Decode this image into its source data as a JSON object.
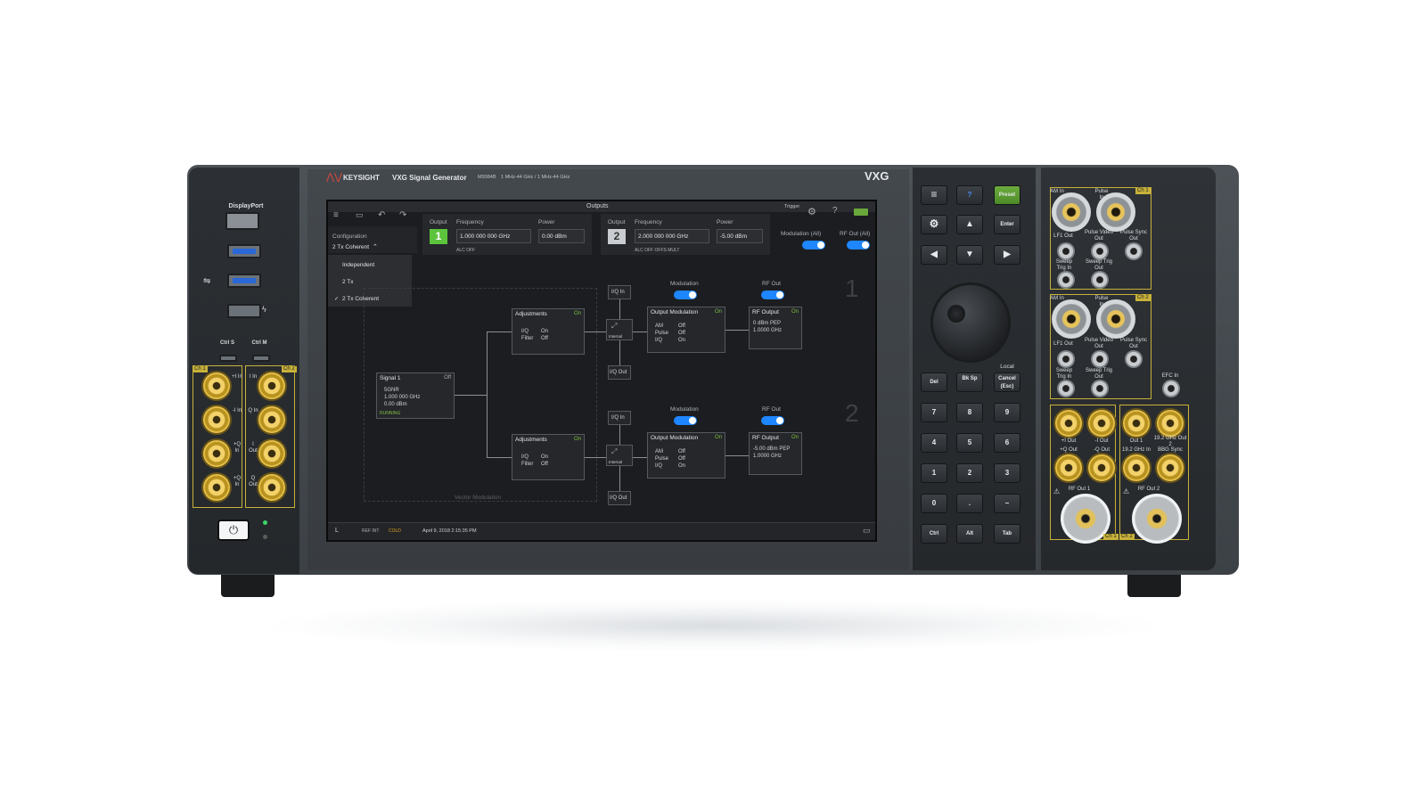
{
  "instrument": {
    "brand": "KEYSIGHT",
    "product": "VXG Signal Generator",
    "model": "M9384B",
    "freq_range": "1 MHz-44 GHz / 1 MHz-44 GHz",
    "badge": "VXG"
  },
  "left_panel": {
    "displayport": "DisplayPort",
    "ctrl_s": "Ctrl S",
    "ctrl_m": "Ctrl M",
    "ch1": "Ch 1",
    "ch2": "Ch 2",
    "port_labels_left": [
      "+I In",
      "-I In",
      "+Q In",
      "+Q In"
    ],
    "port_labels_right": [
      "I In",
      "Q In",
      "I Out",
      "Q Out"
    ]
  },
  "screen": {
    "top_title": "Outputs",
    "trigger": "Trigger",
    "config_label": "Configuration",
    "config_value": "2 Tx Coherent",
    "config_options": [
      "Independent",
      "2 Tx",
      "2 Tx Coherent"
    ],
    "out1": {
      "label": "Output",
      "number": "1",
      "freq_label": "Frequency",
      "freq": "1.000 000 000 GHz",
      "power_label": "Power",
      "power": "0.00 dBm",
      "flags": "ALC OFF"
    },
    "out2": {
      "label": "Output",
      "number": "2",
      "freq_label": "Frequency",
      "freq": "2.000 000 000 GHz",
      "power_label": "Power",
      "power": "-5.00 dBm",
      "flags": "ALC OFF   OFFS   MULT"
    },
    "mod_all": "Modulation (All)",
    "rf_all": "RF Out (All)",
    "signal": {
      "title": "Signal 1",
      "state": "Off",
      "lines": [
        "5GNR",
        "1.000 000 GHz",
        "0.00 dBm"
      ],
      "status": "RUNNING"
    },
    "ch1": {
      "big": "1",
      "iq_in": "I/Q In",
      "iq_out": "I/Q Out",
      "internal": "Internal",
      "modulation": "Modulation",
      "rf_out": "RF Out",
      "adj": {
        "title": "Adjustments",
        "on": "On",
        "k1": "I/Q",
        "v1": "On",
        "k2": "Filter",
        "v2": "Off"
      },
      "outmod": {
        "title": "Output Modulation",
        "on": "On",
        "k1": "AM",
        "v1": "Off",
        "k2": "Pulse",
        "v2": "Off",
        "k3": "I/Q",
        "v3": "On"
      },
      "rf": {
        "title": "RF Output",
        "on": "On",
        "l1": "0 dBm PEP",
        "l2": "1.0000 GHz"
      }
    },
    "ch2": {
      "big": "2",
      "iq_in": "I/Q In",
      "iq_out": "I/Q Out",
      "internal": "Internal",
      "modulation": "Modulation",
      "rf_out": "RF Out",
      "adj": {
        "title": "Adjustments",
        "on": "On",
        "k1": "I/Q",
        "v1": "On",
        "k2": "Filter",
        "v2": "Off"
      },
      "outmod": {
        "title": "Output Modulation",
        "on": "On",
        "k1": "AM",
        "v1": "Off",
        "k2": "Pulse",
        "v2": "Off",
        "k3": "I/Q",
        "v3": "On"
      },
      "rf": {
        "title": "RF Output",
        "on": "On",
        "l1": "-5.00 dBm PEP",
        "l2": "1.0000 GHz"
      }
    },
    "vector_mod": "Vector Modulation",
    "status": {
      "local": "L",
      "ref": "REF INT",
      "cold": "COLD",
      "datetime": "April 9, 2018  2:15:35 PM"
    }
  },
  "keypad": {
    "preset": "Preset",
    "help": "?",
    "enter": "Enter",
    "local": "Local",
    "del": "Del",
    "bksp": "Bk Sp",
    "cancel": "Cancel (Esc)",
    "digits": [
      "7",
      "8",
      "9",
      "4",
      "5",
      "6",
      "1",
      "2",
      "3",
      "0",
      ".",
      "–"
    ],
    "ctrl": "Ctrl",
    "alt": "Alt",
    "tab": "Tab"
  },
  "right_panel": {
    "ch1": "Ch 1",
    "ch2": "Ch 2",
    "labels_top": [
      "AM In",
      "Pulse In",
      "LF1 Out",
      "Pulse Video Out",
      "Pulse Sync Out",
      "Sweep Trig In",
      "Sweep Trig Out"
    ],
    "labels_mid": [
      "AM In",
      "Pulse In",
      "LF1 Out",
      "Pulse Video Out",
      "Pulse Sync Out",
      "Sweep Trig In",
      "Sweep Trig Out",
      "EFC In"
    ],
    "labels_low": [
      "+I Out",
      "-I Out",
      "+Q Out",
      "-Q Out",
      "Out 1",
      "19.2 GHz Out 2",
      "19.2 GHz In",
      "BBG Sync"
    ],
    "rf_out_1": "RF Out 1",
    "rf_out_2": "RF Out 2"
  }
}
